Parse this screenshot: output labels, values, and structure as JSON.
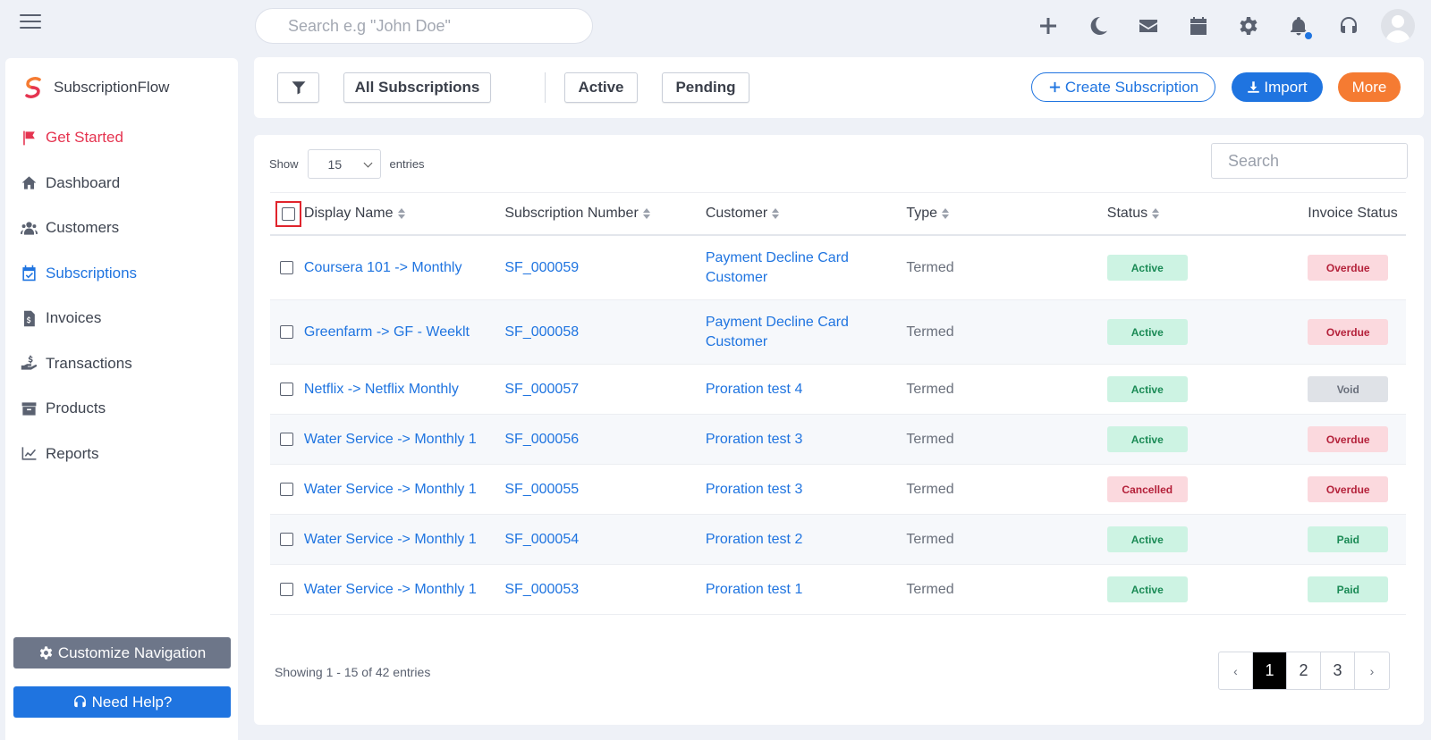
{
  "topbar": {
    "search_placeholder": "Search e.g \"John Doe\""
  },
  "brand": {
    "name": "SubscriptionFlow"
  },
  "sidebar": {
    "items": [
      {
        "label": "Get Started",
        "icon": "flag-icon"
      },
      {
        "label": "Dashboard",
        "icon": "home-icon"
      },
      {
        "label": "Customers",
        "icon": "users-icon"
      },
      {
        "label": "Subscriptions",
        "icon": "calendar-check-icon"
      },
      {
        "label": "Invoices",
        "icon": "invoice-icon"
      },
      {
        "label": "Transactions",
        "icon": "hand-dollar-icon"
      },
      {
        "label": "Products",
        "icon": "archive-icon"
      },
      {
        "label": "Reports",
        "icon": "chart-line-icon"
      }
    ],
    "customize_label": "Customize Navigation",
    "help_label": "Need Help?"
  },
  "filters": {
    "all_label": "All Subscriptions",
    "active_label": "Active",
    "pending_label": "Pending",
    "create_label": "Create Subscription",
    "import_label": "Import",
    "more_label": "More"
  },
  "table": {
    "show_label": "Show",
    "entries_value": "15",
    "entries_label": "entries",
    "search_placeholder": "Search",
    "columns": [
      "Display Name",
      "Subscription Number",
      "Customer",
      "Type",
      "Status",
      "Invoice Status"
    ],
    "rows": [
      {
        "name": "Coursera 101 -> Monthly",
        "number": "SF_000059",
        "customer": "Payment Decline Card Customer",
        "type": "Termed",
        "status": "Active",
        "invoice": "Overdue"
      },
      {
        "name": "Greenfarm -> GF - Weeklt",
        "number": "SF_000058",
        "customer": "Payment Decline Card Customer",
        "type": "Termed",
        "status": "Active",
        "invoice": "Overdue"
      },
      {
        "name": "Netflix -> Netflix Monthly",
        "number": "SF_000057",
        "customer": "Proration test 4",
        "type": "Termed",
        "status": "Active",
        "invoice": "Void"
      },
      {
        "name": "Water Service -> Monthly 1",
        "number": "SF_000056",
        "customer": "Proration test 3",
        "type": "Termed",
        "status": "Active",
        "invoice": "Overdue"
      },
      {
        "name": "Water Service -> Monthly 1",
        "number": "SF_000055",
        "customer": "Proration test 3",
        "type": "Termed",
        "status": "Cancelled",
        "invoice": "Overdue"
      },
      {
        "name": "Water Service -> Monthly 1",
        "number": "SF_000054",
        "customer": "Proration test 2",
        "type": "Termed",
        "status": "Active",
        "invoice": "Paid"
      },
      {
        "name": "Water Service -> Monthly 1",
        "number": "SF_000053",
        "customer": "Proration test 1",
        "type": "Termed",
        "status": "Active",
        "invoice": "Paid"
      }
    ],
    "showing_text": "Showing 1 - 15 of 42 entries",
    "pagination": {
      "prev": "‹",
      "pages": [
        "1",
        "2",
        "3"
      ],
      "next": "›",
      "current": "1"
    }
  }
}
